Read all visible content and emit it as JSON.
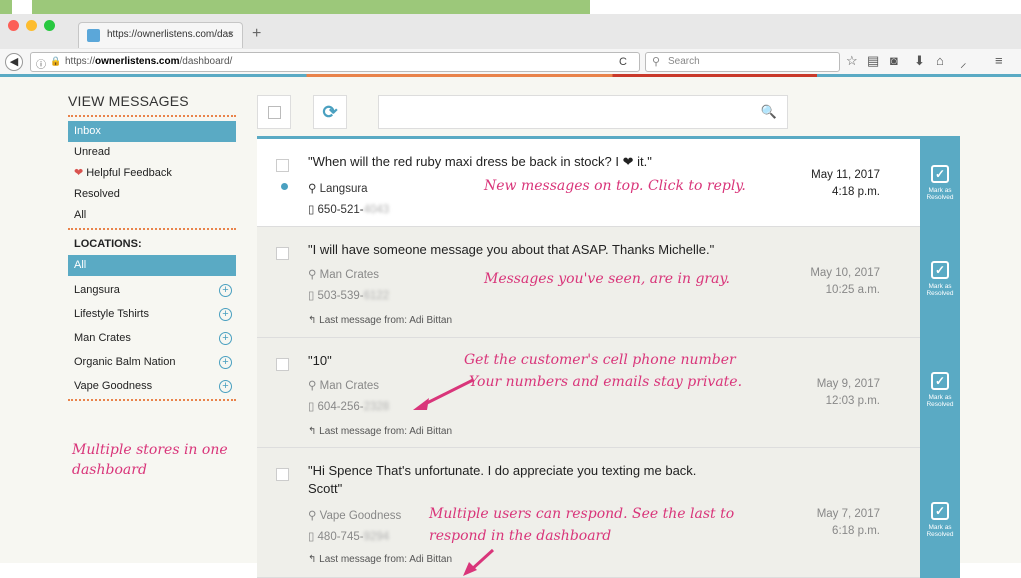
{
  "browser": {
    "tab_title": "https://ownerlistens.com/das",
    "tab_close": "×",
    "new_tab": "+",
    "url_prefix": "https://",
    "url_domain": "ownerlistens.com",
    "url_path": "/dashboard/",
    "search_placeholder": "Search"
  },
  "sidebar": {
    "title": "VIEW MESSAGES",
    "views": [
      {
        "label": "Inbox",
        "active": true
      },
      {
        "label": "Unread"
      },
      {
        "label": "Helpful Feedback",
        "icon": "heart-icon"
      },
      {
        "label": "Resolved"
      },
      {
        "label": "All"
      }
    ],
    "locations_title": "LOCATIONS:",
    "locations": [
      {
        "label": "All",
        "active": true
      },
      {
        "label": "Langsura"
      },
      {
        "label": "Lifestyle Tshirts"
      },
      {
        "label": "Man Crates"
      },
      {
        "label": "Organic Balm Nation"
      },
      {
        "label": "Vape Goodness"
      }
    ],
    "annotation": "Multiple stores in one dashboard"
  },
  "messages": [
    {
      "text": "\"When will the red ruby maxi dress be back in stock? I ❤ it.\"",
      "location": "Langsura",
      "phone_visible": "650-521-",
      "phone_hidden": "4043",
      "date": "May 11, 2017",
      "time": "4:18 p.m.",
      "resolve_label": "Mark as Resolved",
      "annotation": "New messages on top. Click to reply."
    },
    {
      "text": "\"I will have someone message you about that ASAP. Thanks Michelle.\"",
      "location": "Man Crates",
      "phone_visible": "503-539-",
      "phone_hidden": "6122",
      "last_from": "Last message from: Adi Bittan",
      "date": "May 10, 2017",
      "time": "10:25 a.m.",
      "resolve_label": "Mark as Resolved",
      "annotation": "Messages you've seen, are in gray."
    },
    {
      "text": "\"10\"",
      "location": "Man Crates",
      "phone_visible": "604-256-",
      "phone_hidden": "2328",
      "last_from": "Last message from: Adi Bittan",
      "date": "May 9, 2017",
      "time": "12:03 p.m.",
      "resolve_label": "Mark as Resolved",
      "annotation": "Get the customer's cell phone number",
      "annotation2": "Your numbers and emails stay private."
    },
    {
      "text_line1": "\"Hi Spence   That's unfortunate. I do appreciate you texting me back.",
      "text_line2": "Scott\"",
      "location": "Vape Goodness",
      "phone_visible": "480-745-",
      "phone_hidden": "9294",
      "last_from": "Last message from: Adi Bittan",
      "date": "May 7, 2017",
      "time": "6:18 p.m.",
      "resolve_label": "Mark as Resolved",
      "annotation": "Multiple users can respond. See the last to",
      "annotation2": "respond in the dashboard"
    }
  ],
  "colors": {
    "accent": "#5aaac4",
    "annotation": "#d9357a",
    "dotted": "#e9834b"
  }
}
